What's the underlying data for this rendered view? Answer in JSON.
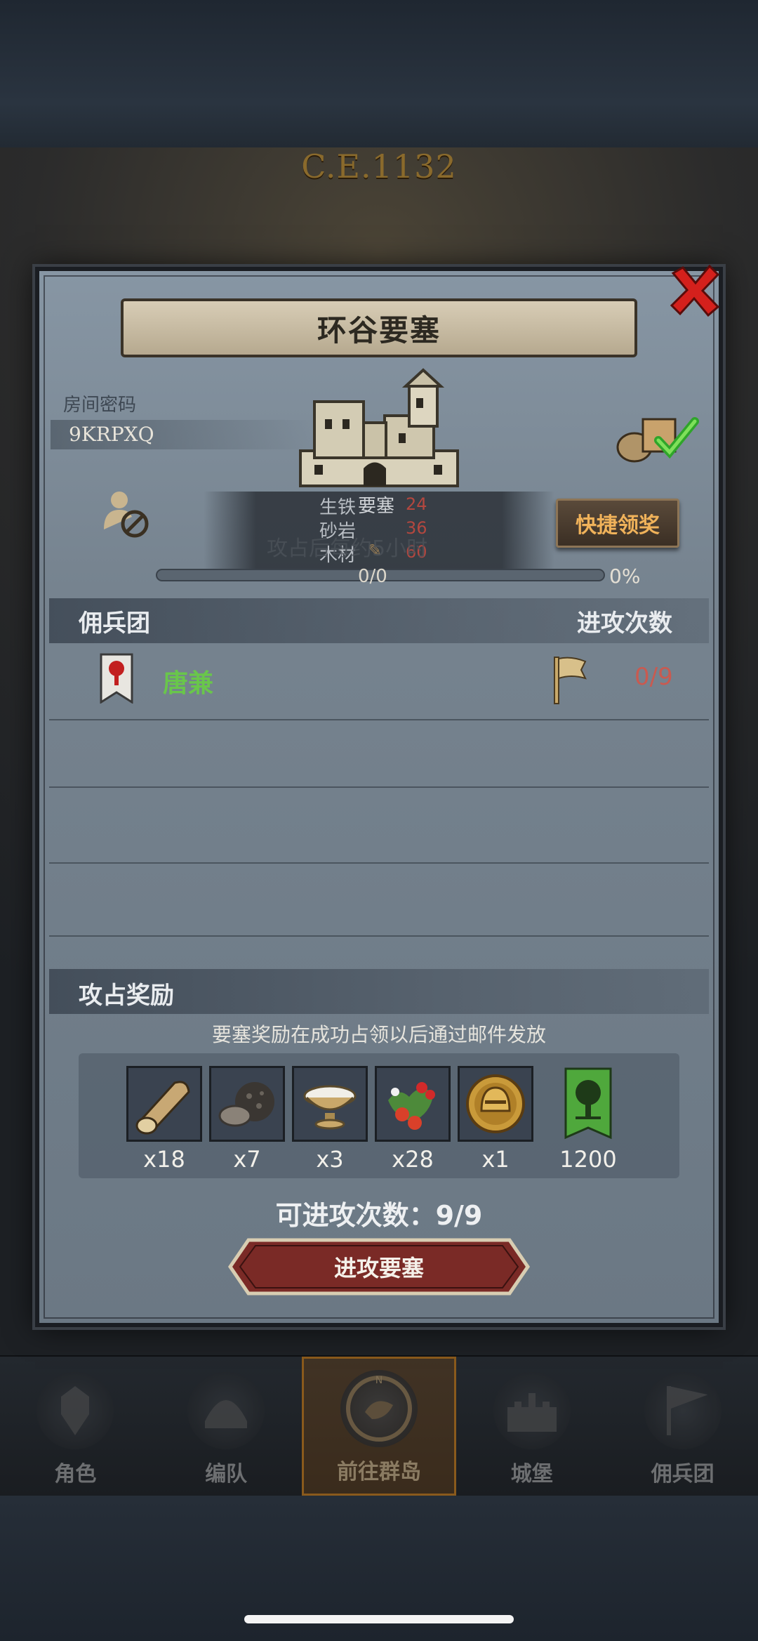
{
  "background": {
    "era_label": "C.E.1132"
  },
  "dialog": {
    "title": "环谷要塞",
    "room_code_label": "房间密码",
    "room_code": "9KRPXQ",
    "resources": [
      {
        "name": "生铁",
        "value": "24"
      },
      {
        "name": "砂岩",
        "value": "36"
      },
      {
        "name": "木材",
        "value": "60"
      }
    ],
    "fortress_label": "要塞",
    "occupy_text": "攻占后每约5小时",
    "quick_claim_label": "快捷领奖",
    "progress": {
      "text": "0/0",
      "percent": "0%",
      "fraction": 0
    }
  },
  "mercenary": {
    "section_title": "佣兵团",
    "attack_times_title": "进攻次数",
    "entries": [
      {
        "name": "唐兼",
        "attacks": "0/9"
      }
    ]
  },
  "rewards": {
    "section_title": "攻占奖励",
    "note": "要塞奖励在成功占领以后通过邮件发放",
    "items": [
      {
        "icon": "wood-log-icon",
        "qty": "x18"
      },
      {
        "icon": "truffle-icon",
        "qty": "x7"
      },
      {
        "icon": "salt-bowl-icon",
        "qty": "x3"
      },
      {
        "icon": "berries-icon",
        "qty": "x28"
      },
      {
        "icon": "golden-helmet-coin-icon",
        "qty": "x1"
      },
      {
        "icon": "tree-banner-icon",
        "qty": "1200"
      }
    ],
    "attempts_label": "可进攻次数：9/9",
    "attack_button_label": "进攻要塞"
  },
  "nav": {
    "items": [
      {
        "label": "角色",
        "active": false
      },
      {
        "label": "编队",
        "active": false
      },
      {
        "label": "前往群岛",
        "active": true
      },
      {
        "label": "城堡",
        "active": false
      },
      {
        "label": "佣兵团",
        "active": false
      }
    ]
  },
  "colors": {
    "accent_gold": "#f0b25a",
    "merc_green": "#69c64b",
    "count_red": "#c95a50",
    "close_red": "#d4201c"
  }
}
